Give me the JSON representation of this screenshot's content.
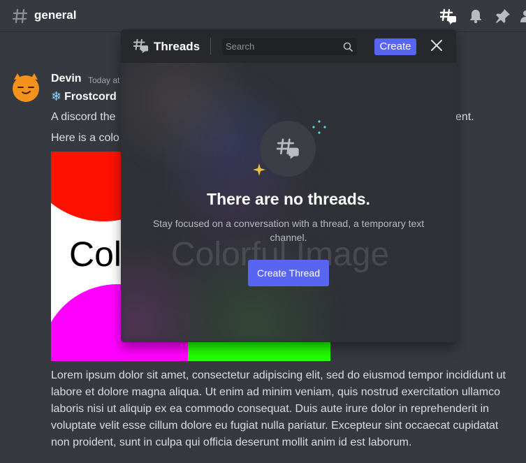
{
  "channel": {
    "name": "general"
  },
  "header_icons": [
    "threads-icon",
    "bell-icon",
    "pin-icon",
    "members-icon"
  ],
  "message": {
    "author": "Devin",
    "timestamp": "Today at",
    "role_name": "Frostcord",
    "line1_start": "A discord the",
    "line1_end": "ent.",
    "line2": "Here is a colo",
    "image_text": "Colorful Image",
    "image_colors": {
      "red": "#ff1100",
      "magenta": "#ff00ff",
      "green": "#22ff00",
      "white": "#ffffff"
    },
    "body": "Lorem ipsum dolor sit amet, consectetur adipiscing elit, sed do eiusmod tempor incididunt ut labore et dolore magna aliqua. Ut enim ad minim veniam, quis nostrud exercitation ullamco laboris nisi ut aliquip ex ea commodo consequat. Duis aute irure dolor in reprehenderit in voluptate velit esse cillum dolore eu fugiat nulla pariatur. Excepteur sint occaecat cupidatat non proident, sunt in culpa qui officia deserunt mollit anim id est laborum."
  },
  "threads_popout": {
    "title": "Threads",
    "search_placeholder": "Search",
    "create_label": "Create",
    "empty_title": "There are no threads.",
    "empty_subtitle": "Stay focused on a conversation with a thread, a temporary text channel.",
    "create_thread_label": "Create Thread"
  },
  "colors": {
    "accent": "#5865f2",
    "background": "#36393f",
    "popout": "#2f3136"
  }
}
